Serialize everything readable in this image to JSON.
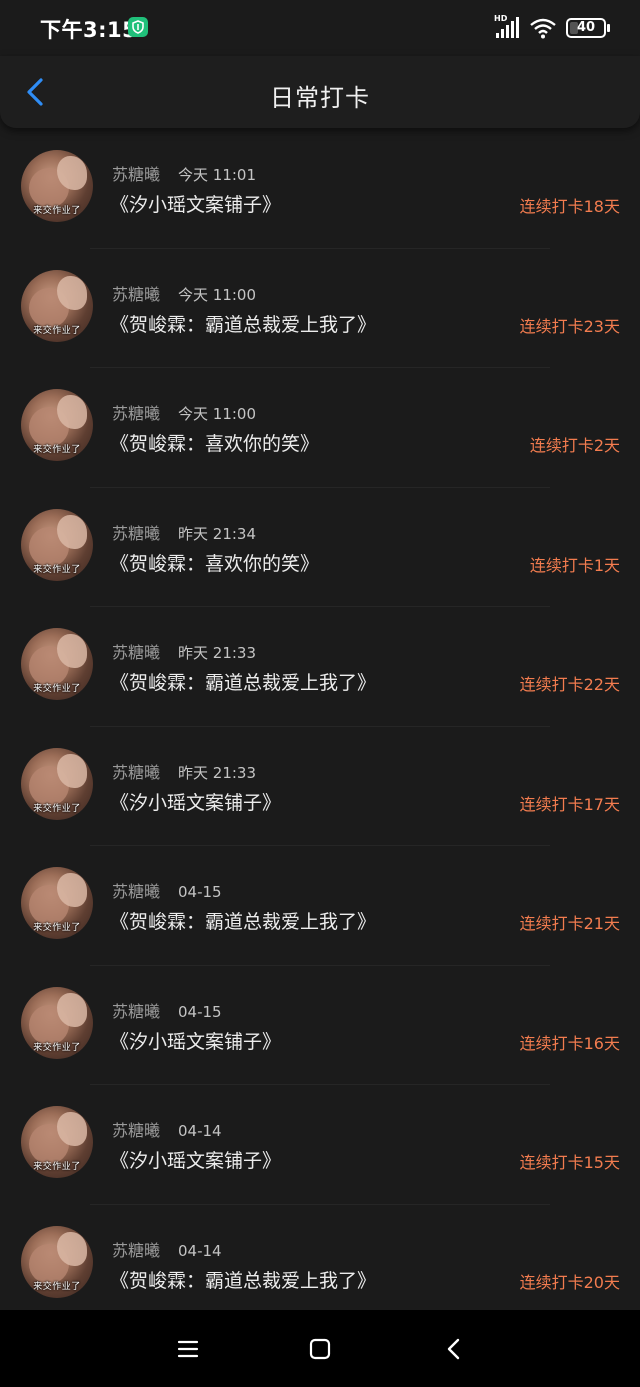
{
  "status_bar": {
    "time": "下午3:15",
    "network": "HD",
    "battery": "40"
  },
  "header": {
    "title": "日常打卡"
  },
  "avatar_caption": "来交作业了",
  "items": [
    {
      "name": "苏糖曦",
      "time": "今天 11:01",
      "book": "《汐小瑶文案铺子》",
      "streak": "连续打卡18天"
    },
    {
      "name": "苏糖曦",
      "time": "今天 11:00",
      "book": "《贺峻霖：霸道总裁爱上我了》",
      "streak": "连续打卡23天"
    },
    {
      "name": "苏糖曦",
      "time": "今天 11:00",
      "book": "《贺峻霖：喜欢你的笑》",
      "streak": "连续打卡2天"
    },
    {
      "name": "苏糖曦",
      "time": "昨天 21:34",
      "book": "《贺峻霖：喜欢你的笑》",
      "streak": "连续打卡1天"
    },
    {
      "name": "苏糖曦",
      "time": "昨天 21:33",
      "book": "《贺峻霖：霸道总裁爱上我了》",
      "streak": "连续打卡22天"
    },
    {
      "name": "苏糖曦",
      "time": "昨天 21:33",
      "book": "《汐小瑶文案铺子》",
      "streak": "连续打卡17天"
    },
    {
      "name": "苏糖曦",
      "time": "04-15",
      "book": "《贺峻霖：霸道总裁爱上我了》",
      "streak": "连续打卡21天"
    },
    {
      "name": "苏糖曦",
      "time": "04-15",
      "book": "《汐小瑶文案铺子》",
      "streak": "连续打卡16天"
    },
    {
      "name": "苏糖曦",
      "time": "04-14",
      "book": "《汐小瑶文案铺子》",
      "streak": "连续打卡15天"
    },
    {
      "name": "苏糖曦",
      "time": "04-14",
      "book": "《贺峻霖：霸道总裁爱上我了》",
      "streak": "连续打卡20天"
    }
  ],
  "colors": {
    "background": "#1b1b1b",
    "accent_back": "#2f8df5",
    "streak": "#f27c4f",
    "shield": "#20c07a"
  },
  "icons": {
    "back": "chevron-left-icon",
    "shield": "shield-icon",
    "signal": "signal-icon",
    "wifi": "wifi-icon",
    "battery": "battery-icon",
    "nav_menu": "menu-icon",
    "nav_home": "home-square-icon",
    "nav_back": "back-triangle-icon"
  }
}
